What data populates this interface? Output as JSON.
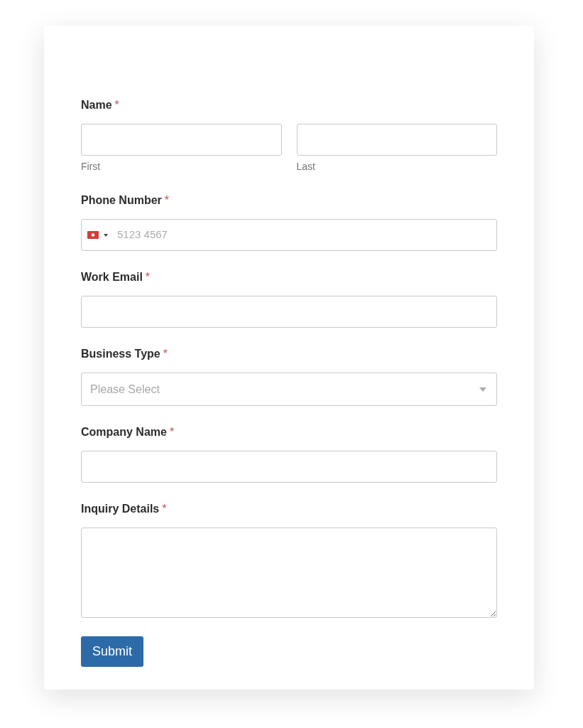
{
  "form": {
    "fields": [
      {
        "kind": "name",
        "label": "Name",
        "required_mark": "*",
        "parts": [
          {
            "sublabel": "First"
          },
          {
            "sublabel": "Last"
          }
        ]
      },
      {
        "kind": "phone",
        "label": "Phone Number",
        "required_mark": "*",
        "placeholder": "5123 4567"
      },
      {
        "kind": "text",
        "label": "Work Email",
        "required_mark": "*"
      },
      {
        "kind": "select",
        "label": "Business Type",
        "required_mark": "*",
        "placeholder": "Please Select"
      },
      {
        "kind": "text",
        "label": "Company Name",
        "required_mark": "*"
      },
      {
        "kind": "textarea",
        "label": "Inquiry Details",
        "required_mark": "*"
      }
    ],
    "submit": "Submit"
  }
}
